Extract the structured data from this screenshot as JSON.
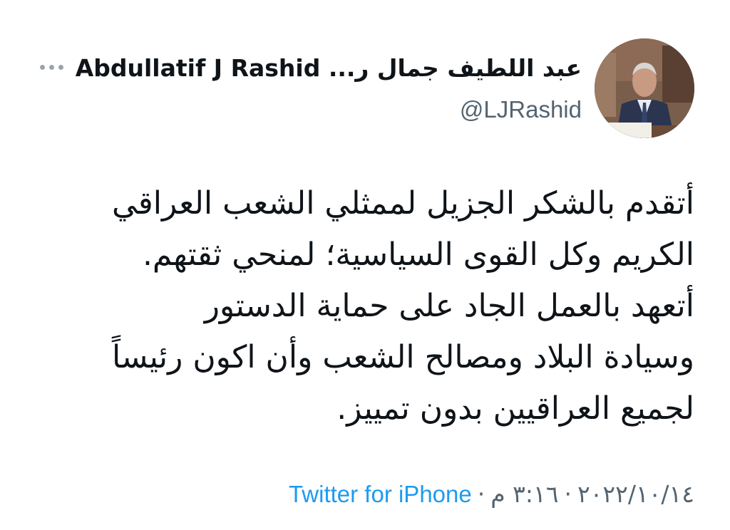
{
  "author": {
    "display_name": "عبد اللطيف جمال ر... Abdullatif J Rashid",
    "handle": "@LJRashid",
    "avatar_icon": "profile-photo"
  },
  "menu": {
    "icon": "more-options-icon"
  },
  "tweet": {
    "lines": [
      "أتقدم بالشكر الجزيل لممثلي الشعب العراقي",
      "الكريم وكل القوى السياسية؛ لمنحي ثقتهم.",
      "أتعهد بالعمل الجاد على حماية الدستور",
      "وسيادة البلاد ومصالح الشعب وأن اكون رئيساً",
      "لجميع العراقيين بدون تمييز."
    ]
  },
  "meta": {
    "time": "٣:١٦ م",
    "date": "٢٠٢٢/١٠/١٤",
    "separator": "·",
    "source": "Twitter for iPhone"
  },
  "colors": {
    "text": "#0f1419",
    "secondary": "#536471",
    "link": "#1d9bf0"
  }
}
